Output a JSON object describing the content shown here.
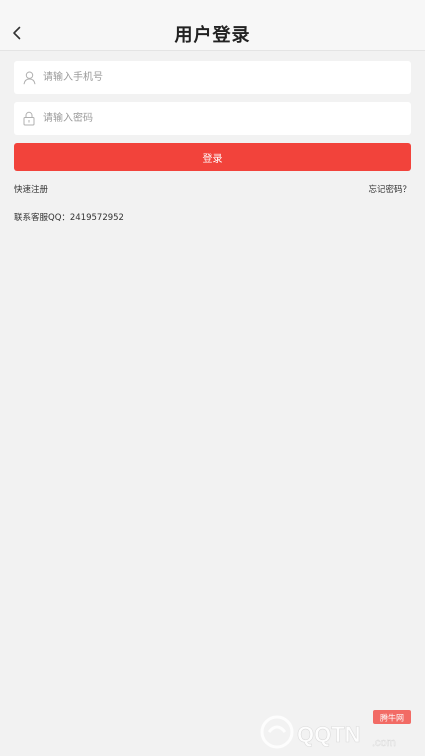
{
  "header": {
    "title": "用户登录",
    "back_icon": "chevron-left-icon"
  },
  "form": {
    "phone": {
      "placeholder": "请输入手机号",
      "value": "",
      "icon": "user-icon"
    },
    "password": {
      "placeholder": "请输入密码",
      "value": "",
      "icon": "lock-icon"
    },
    "login_label": "登录"
  },
  "links": {
    "register": "快速注册",
    "forgot": "忘记密码？"
  },
  "service": {
    "text": "联系客服QQ：2419572952"
  },
  "watermark": {
    "small_text": "腾牛网",
    "main_text": "QQTN",
    "suffix": ".com"
  },
  "colors": {
    "accent": "#f2433b",
    "background": "#f2f2f2"
  }
}
